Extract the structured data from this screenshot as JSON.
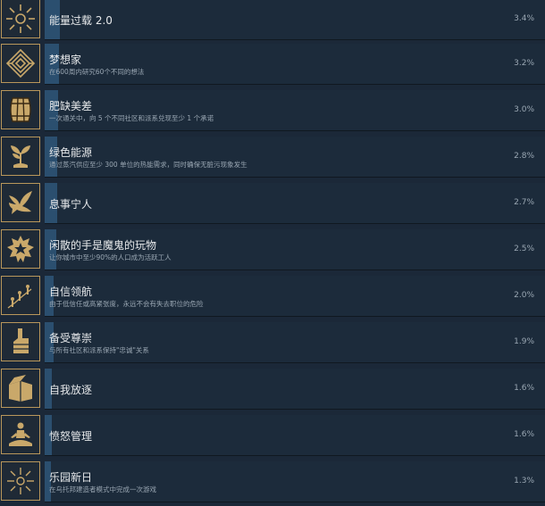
{
  "colors": {
    "background": "#1b2838",
    "bar": "#1c2b3b",
    "fill": "#2b4f6f",
    "icon_border": "#b9975b",
    "icon_gold": "#c9a86a"
  },
  "achievements": [
    {
      "icon": "sun-burst-icon",
      "title": "能量过载 2.0",
      "description": "",
      "percent": "3.4%",
      "progress": 0.034
    },
    {
      "icon": "maze-icon",
      "title": "梦想家",
      "description": "在600周内研究60个不同的想法",
      "percent": "3.2%",
      "progress": 0.032
    },
    {
      "icon": "barrel-icon",
      "title": "肥缺美差",
      "description": "一次通关中，向 5 个不同社区和派系兑现至少 1 个承诺",
      "percent": "3.0%",
      "progress": 0.03
    },
    {
      "icon": "sprout-icon",
      "title": "绿色能源",
      "description": "通过蒸汽供应至少 300 单位的热能需求，同时确保无脏污现象发生",
      "percent": "2.8%",
      "progress": 0.028
    },
    {
      "icon": "dove-icon",
      "title": "息事宁人",
      "description": "",
      "percent": "2.7%",
      "progress": 0.027
    },
    {
      "icon": "star-badge-icon",
      "title": "闲散的手是魔鬼的玩物",
      "description": "让你城市中至少90%的人口成为活跃工人",
      "percent": "2.5%",
      "progress": 0.025
    },
    {
      "icon": "climbing-figures-icon",
      "title": "自信领航",
      "description": "由于低信任或高紧张度，永远不会有失去职位的危险",
      "percent": "2.0%",
      "progress": 0.02
    },
    {
      "icon": "foam-finger-icon",
      "title": "备受尊崇",
      "description": "与所有社区和派系保持\"忠诚\"关系",
      "percent": "1.9%",
      "progress": 0.019
    },
    {
      "icon": "open-box-icon",
      "title": "自我放逐",
      "description": "",
      "percent": "1.6%",
      "progress": 0.016
    },
    {
      "icon": "meditation-icon",
      "title": "愤怒管理",
      "description": "",
      "percent": "1.6%",
      "progress": 0.016
    },
    {
      "icon": "sunrise-icon",
      "title": "乐园新日",
      "description": "在乌托邦建造者模式中完成一次游戏",
      "percent": "1.3%",
      "progress": 0.013
    }
  ]
}
